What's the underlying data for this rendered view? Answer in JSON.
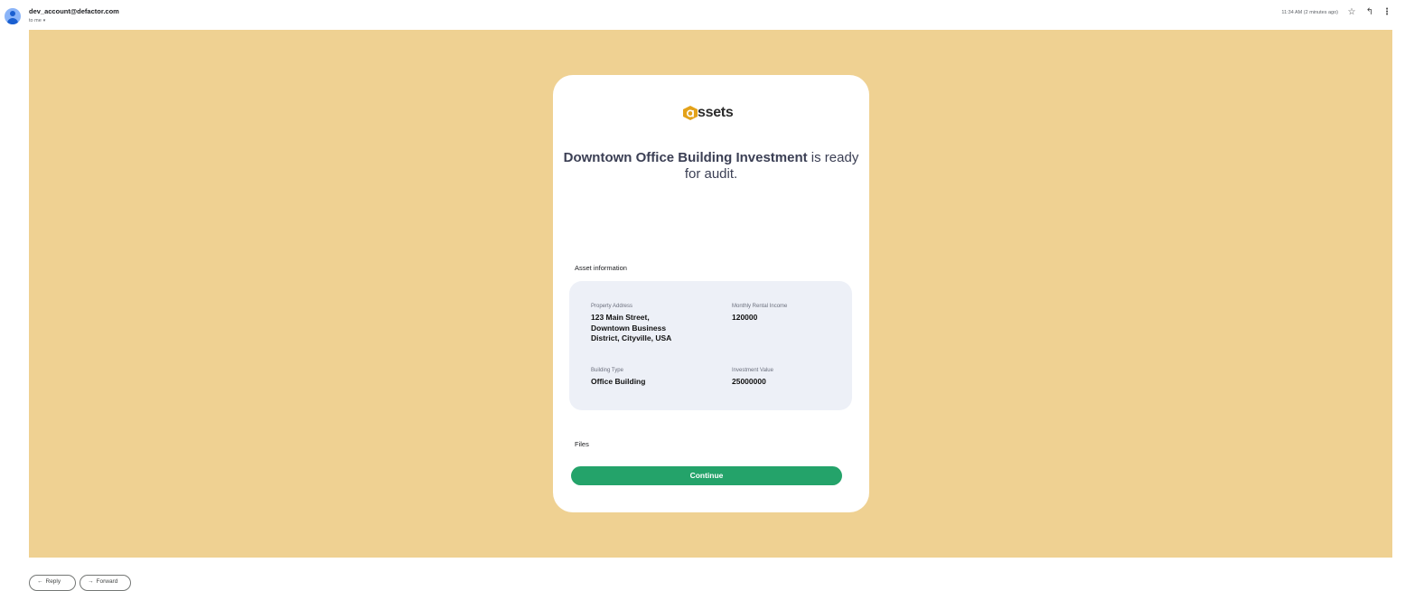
{
  "email": {
    "sender": "dev_account@defactor.com",
    "recipient": "to me",
    "timestamp": "11:34 AM (2 minutes ago)",
    "icons": {
      "avatar": "person-avatar-icon",
      "star": "star-icon",
      "reply": "reply-icon",
      "more": "more-vertical-icon"
    }
  },
  "body": {
    "background_color": "#efd192",
    "logo_text": "ssets",
    "logo_color": "#e3a21a",
    "headline": {
      "asset_name": "Downtown Office Building Investment",
      "suffix": " is ready for audit."
    },
    "asset_section_label": "Asset information",
    "fields": {
      "address": {
        "label": "Property Address",
        "value": "123 Main Street, Downtown Business District, Cityville, USA"
      },
      "rent": {
        "label": "Monthly Rental Income",
        "value": "120000"
      },
      "type": {
        "label": "Building Type",
        "value": "Office Building"
      },
      "investment": {
        "label": "Investment Value",
        "value": "25000000"
      }
    },
    "files_section_label": "Files",
    "continue_label": "Continue",
    "accent_color": "#24a36a"
  },
  "footer": {
    "reply_label": "Reply",
    "forward_label": "Forward"
  }
}
